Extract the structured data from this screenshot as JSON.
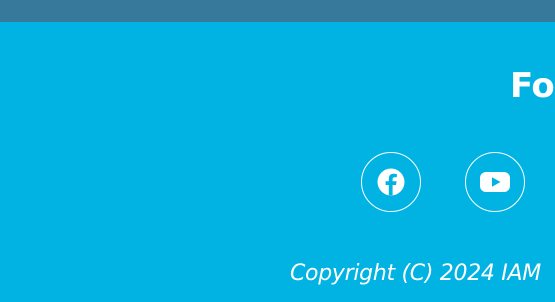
{
  "header": {
    "bar_color": "#36799a"
  },
  "footer": {
    "background_color": "#00b3e3",
    "heading": "Fo",
    "social_links": [
      {
        "name": "Facebook",
        "icon": "facebook-icon"
      },
      {
        "name": "YouTube",
        "icon": "youtube-icon"
      }
    ],
    "copyright": "Copyright (C) 2024 IAM"
  }
}
